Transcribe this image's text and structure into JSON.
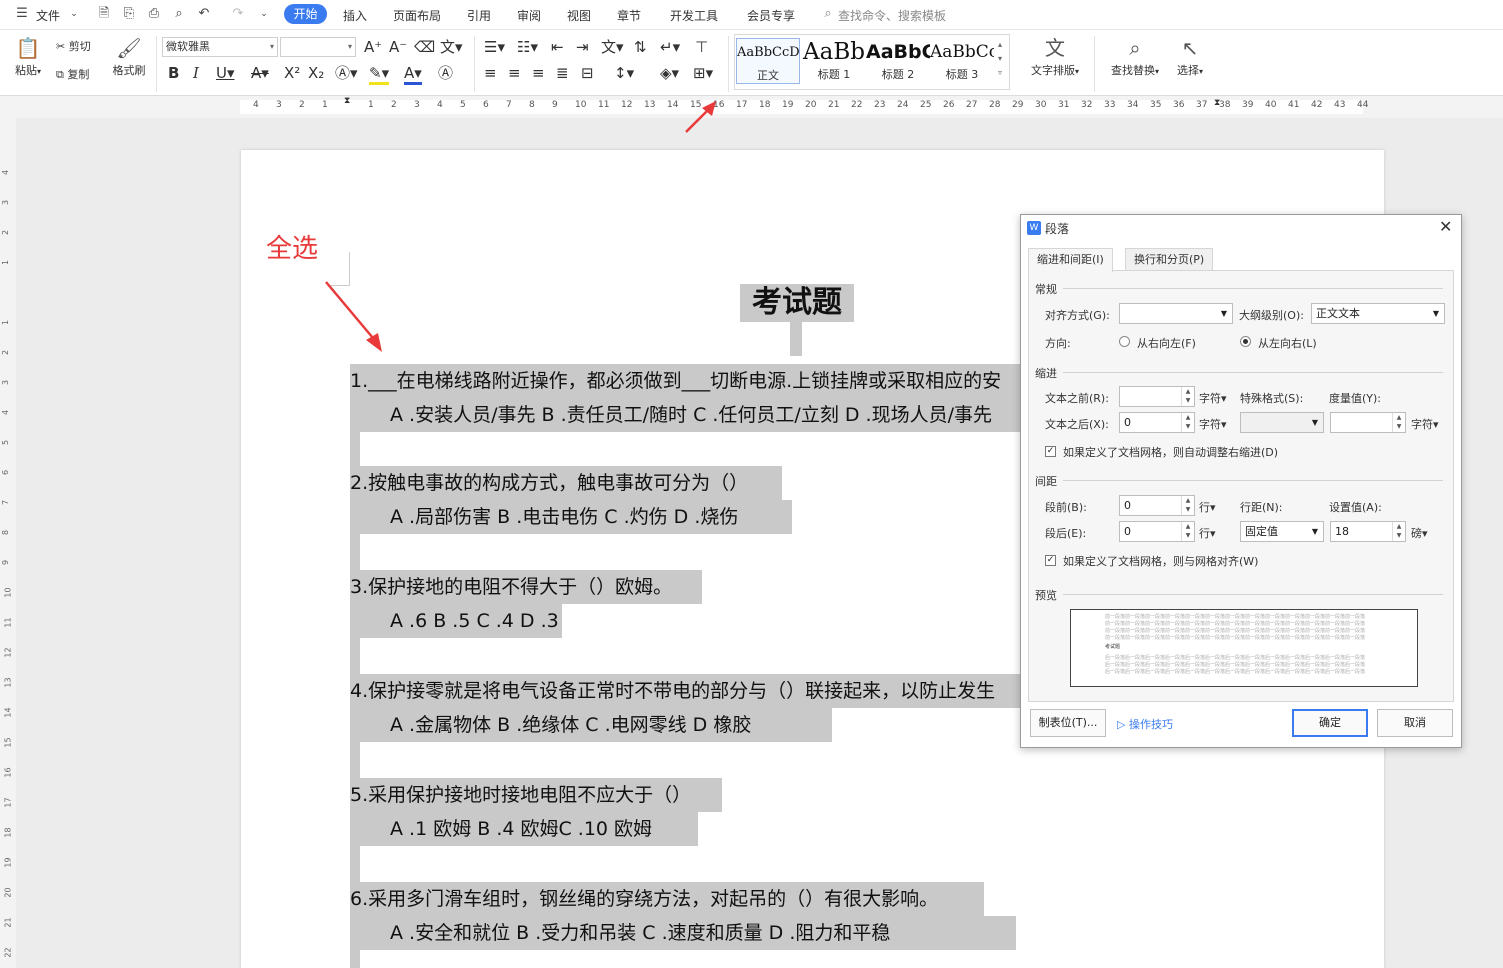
{
  "menu": {
    "file": "文件",
    "tabs": [
      "开始",
      "插入",
      "页面布局",
      "引用",
      "审阅",
      "视图",
      "章节",
      "开发工具",
      "会员专享"
    ],
    "search_placeholder": "查找命令、搜索模板"
  },
  "toolbar": {
    "paste": "粘贴",
    "cut": "剪切",
    "copy": "复制",
    "format_painter": "格式刷",
    "font_name": "微软雅黑",
    "font_size": "",
    "styles": [
      {
        "preview": "AaBbCcDd",
        "label": "正文"
      },
      {
        "preview": "AaBb",
        "label": "标题 1"
      },
      {
        "preview": "AaBbC",
        "label": "标题 2"
      },
      {
        "preview": "AaBbCc",
        "label": "标题 3"
      }
    ],
    "text_layout": "文字排版",
    "find_replace": "查找替换",
    "select": "选择"
  },
  "ruler": {
    "h_numbers": [
      "4",
      "3",
      "2",
      "1",
      "",
      "1",
      "2",
      "3",
      "4",
      "5",
      "6",
      "7",
      "8",
      "9",
      "10",
      "11",
      "12",
      "13",
      "14",
      "15",
      "16",
      "17",
      "18",
      "19",
      "20",
      "21",
      "22",
      "23",
      "24",
      "25",
      "26",
      "27",
      "28",
      "29",
      "30",
      "31",
      "32",
      "33",
      "34",
      "35",
      "36",
      "37",
      "38",
      "39",
      "40",
      "41",
      "42",
      "43",
      "44"
    ],
    "v_numbers": [
      "4",
      "3",
      "2",
      "1",
      "",
      "1",
      "2",
      "3",
      "4",
      "5",
      "6",
      "7",
      "8",
      "9",
      "10",
      "11",
      "12",
      "13",
      "14",
      "15",
      "16",
      "17",
      "18",
      "19",
      "20",
      "21",
      "22"
    ]
  },
  "annotation": "全选",
  "document": {
    "title": "考试题",
    "lines": [
      "1.___在电梯线路附近操作，都必须做到___切断电源.上锁挂牌或采取相应的安",
      "A .安装人员/事先  B .责任员工/随时  C .任何员工/立刻  D .现场人员/事先",
      "2.按触电事故的构成方式，触电事故可分为（）",
      "A .局部伤害   B .电击电伤    C .灼伤    D .烧伤",
      "3.保护接地的电阻不得大于（）欧姆。",
      "A .6 B .5 C .4 D .3",
      "4.保护接零就是将电气设备正常时不带电的部分与（）联接起来，以防止发生",
      "A .金属物体   B .绝缘体       C .电网零线   D  橡胶",
      "5.采用保护接地时接地电阻不应大于（）",
      "A .1 欧姆       B .4 欧姆C .10 欧姆",
      "6.采用多门滑车组时，钢丝绳的穿绕方法，对起吊的（）有很大影响。",
      "A .安全和就位      B .受力和吊装       C .速度和质量       D .阻力和平稳"
    ]
  },
  "dialog": {
    "title": "段落",
    "tab1": "缩进和间距(I)",
    "tab2": "换行和分页(P)",
    "general": "常规",
    "align_label": "对齐方式(G):",
    "align_value": "",
    "outline_label": "大纲级别(O):",
    "outline_value": "正文文本",
    "direction_label": "方向:",
    "rtl": "从右向左(F)",
    "ltr": "从左向右(L)",
    "indent": "缩进",
    "before_text_label": "文本之前(R):",
    "before_text_value": "",
    "after_text_label": "文本之后(X):",
    "after_text_value": "0",
    "unit_char": "字符",
    "special_label": "特殊格式(S):",
    "special_value": "",
    "measure_label": "度量值(Y):",
    "measure_value": "",
    "auto_indent": "如果定义了文档网格，则自动调整右缩进(D)",
    "spacing": "间距",
    "before_label": "段前(B):",
    "before_value": "0",
    "after_label": "段后(E):",
    "after_value": "0",
    "unit_line": "行",
    "line_spacing_label": "行距(N):",
    "line_spacing_value": "固定值",
    "setting_label": "设置值(A):",
    "setting_value": "18",
    "unit_pound": "磅",
    "snap_grid": "如果定义了文档网格，则与网格对齐(W)",
    "preview": "预览",
    "preview_prev": "前一段落前一段落前一段落前一段落前一段落前一段落前一段落前一段落前一段落前一段落前一段落前一段落前一段落",
    "preview_sample": "考试题",
    "preview_next": "后一段落后一段落后一段落后一段落后一段落后一段落后一段落后一段落后一段落后一段落后一段落后一段落后一段落",
    "tabs_button": "制表位(T)...",
    "tips": "操作技巧",
    "ok": "确定",
    "cancel": "取消"
  },
  "colors": {
    "accent": "#3a7bf0",
    "annotation": "#e83a3a",
    "selection": "#c9c9c9"
  }
}
